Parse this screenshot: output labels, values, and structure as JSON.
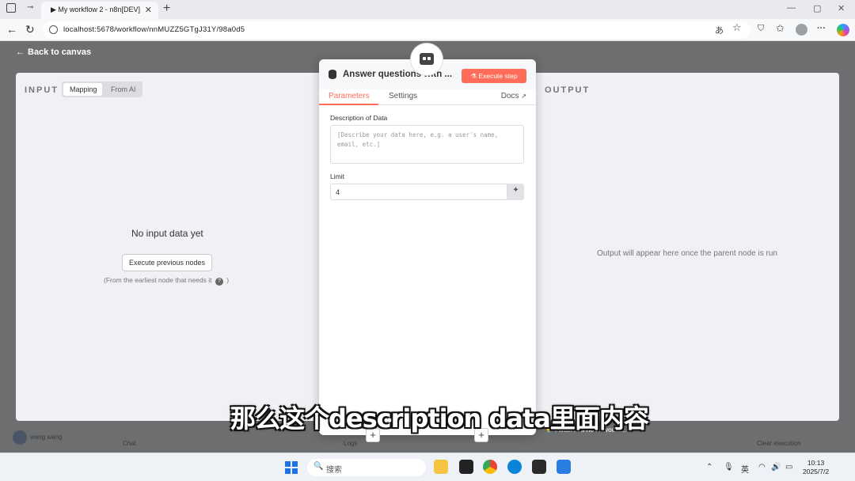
{
  "browser": {
    "tab_title": "My workflow 2 - n8n[DEV]",
    "tab_close": "✕",
    "new_tab": "+",
    "url": "localhost:5678/workflow/nnMUZZ5GTgJ31Y/98a0d5",
    "back": "←",
    "reload": "↻",
    "min": "—",
    "max": "▢",
    "close": "✕",
    "read_aloud": "あ",
    "favorite": "☆",
    "ext": "⛉",
    "collections": "✩",
    "more": "···"
  },
  "n8n": {
    "back_to_canvas": "Back to canvas",
    "input": {
      "heading": "INPUT",
      "mode_mapping": "Mapping",
      "mode_from_ai": "From AI",
      "empty_title": "No input data yet",
      "execute_previous": "Execute previous nodes",
      "hint_before": "(From the earliest node that needs it",
      "hint_q": "?",
      "hint_after": ")"
    },
    "output": {
      "heading": "OUTPUT",
      "message": "Output will appear here once the parent node is run"
    },
    "node": {
      "title": "Answer questions with ...",
      "execute_step": "Execute step",
      "tab_parameters": "Parameters",
      "tab_settings": "Settings",
      "docs": "Docs",
      "description_label": "Description of Data",
      "description_placeholder": "[Describe your data here, e.g. a user's name, email, etc.]",
      "limit_label": "Limit",
      "limit_value": "4",
      "plus": "+"
    },
    "footer": {
      "user": "wang wang",
      "chat": "Chat",
      "logs": "Logs",
      "wish": "I wish this node would...",
      "clear_execution": "Clear execution"
    }
  },
  "subtitle": "那么这个description data里面内容",
  "taskbar": {
    "search_placeholder": "搜索",
    "ime": "英",
    "time": "10:13",
    "date": "2025/7/2"
  },
  "colors": {
    "accent": "#ff6d5a",
    "overlay": "#6d6e70",
    "panel": "#f0f1f4"
  }
}
